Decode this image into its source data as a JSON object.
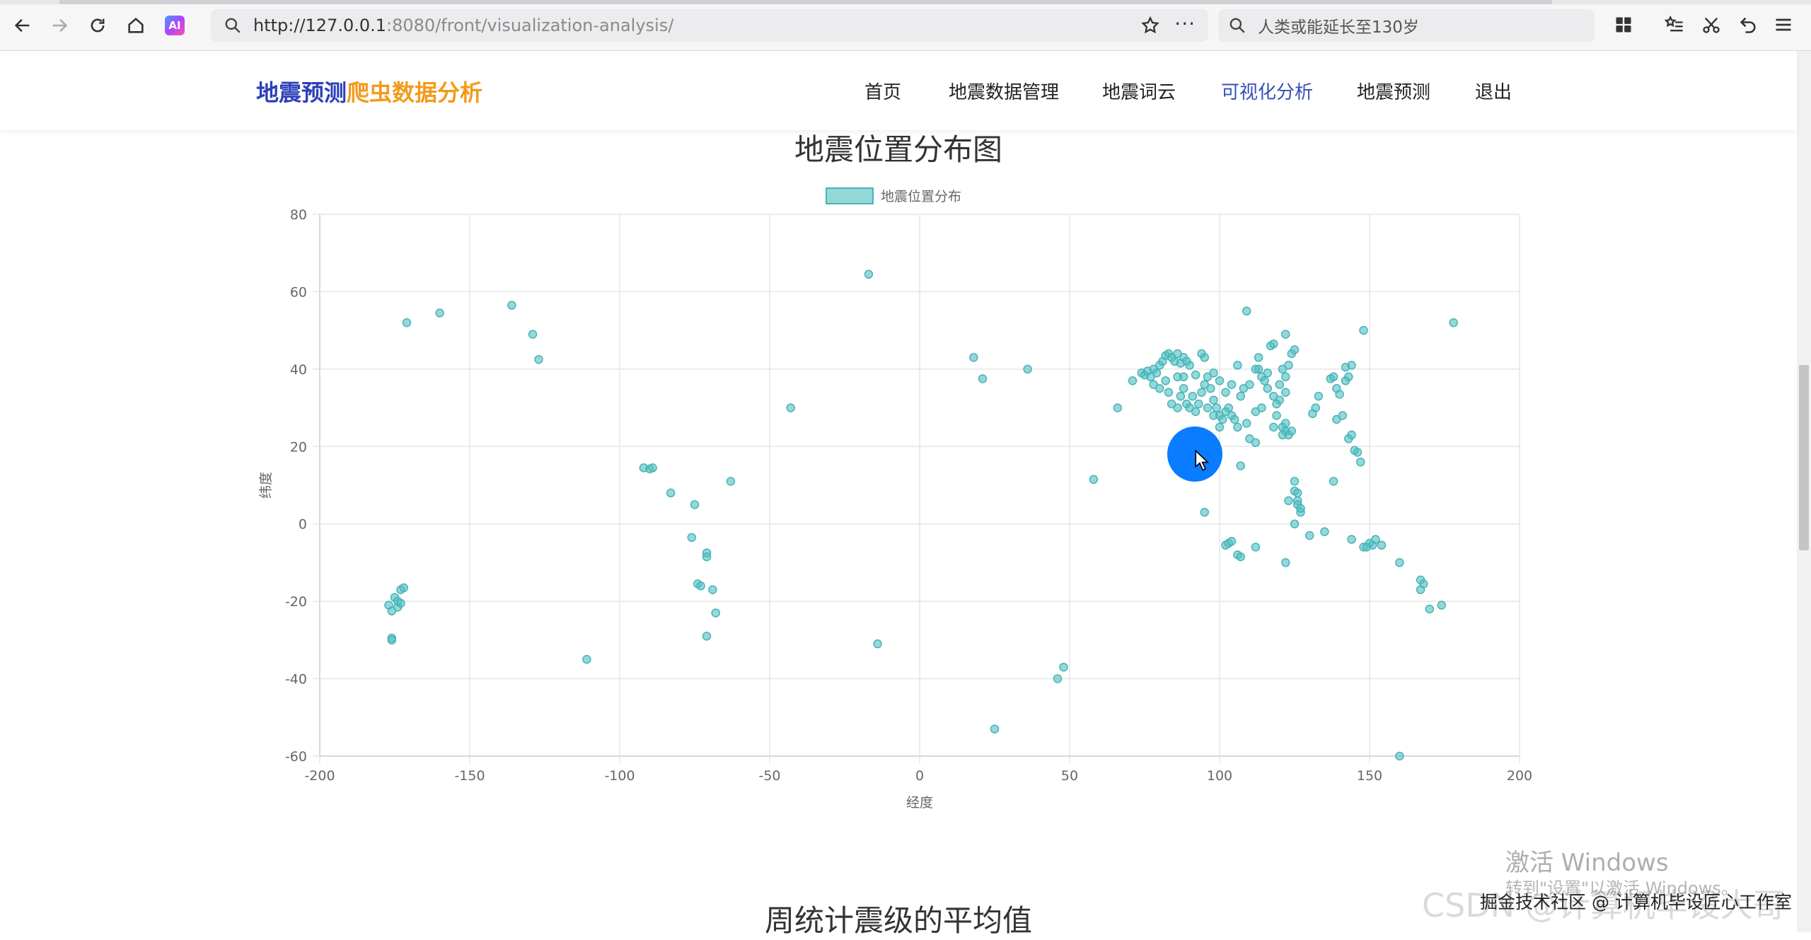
{
  "browser": {
    "url_host": "http://127.0.0.1",
    "url_rest": ":8080/front/visualization-analysis/",
    "search_placeholder": "人类或能延长至130岁",
    "ai_label": "AI",
    "more_label": "···"
  },
  "site": {
    "logo_part1": "地震预测",
    "logo_part2": "爬虫数据分析",
    "nav": [
      "首页",
      "地震数据管理",
      "地震词云",
      "可视化分析",
      "地震预测",
      "退出"
    ],
    "active_nav": "可视化分析"
  },
  "chart_title": "地震位置分布图",
  "section2_title": "周统计震级的平均值",
  "watermark": {
    "line1": "激活 Windows",
    "line2": "转到\"设置\"以激活 Windows。",
    "csdn": "CSDN @计算机毕设大哥",
    "credit": "掘金技术社区 @ 计算机毕设匠心工作室"
  },
  "colors": {
    "point_fill": "rgba(75,192,192,0.6)",
    "point_stroke": "#4bb3b8",
    "grid": "#e6e6e6",
    "active_nav": "#3650b8",
    "logo_blue": "#2d40b8",
    "logo_orange": "#f39a1a"
  },
  "chart_data": {
    "type": "scatter",
    "legend": "地震位置分布",
    "legend_position": "top-center",
    "grid": true,
    "xlabel": "经度",
    "ylabel": "纬度",
    "xlim": [
      -200,
      200
    ],
    "ylim": [
      -60,
      80
    ],
    "xticks": [
      -200,
      -150,
      -100,
      -50,
      0,
      50,
      100,
      150,
      200
    ],
    "yticks": [
      80,
      60,
      40,
      20,
      0,
      -20,
      -40,
      -60
    ],
    "points": [
      [
        -171,
        52
      ],
      [
        -160,
        54.5
      ],
      [
        -136,
        56.5
      ],
      [
        -129,
        49
      ],
      [
        -127,
        42.5
      ],
      [
        -177,
        -21
      ],
      [
        -176,
        -22.5
      ],
      [
        -175,
        -19
      ],
      [
        -174,
        -21.5
      ],
      [
        -173,
        -17
      ],
      [
        -172,
        -16.5
      ],
      [
        -174,
        -20
      ],
      [
        -176,
        -29.5
      ],
      [
        -176,
        -30
      ],
      [
        -173,
        -20.5
      ],
      [
        -111,
        -35
      ],
      [
        -92,
        14.5
      ],
      [
        -90,
        14.2
      ],
      [
        -89,
        14.5
      ],
      [
        -83,
        8
      ],
      [
        -76,
        -3.5
      ],
      [
        -75,
        5
      ],
      [
        -74,
        -15.5
      ],
      [
        -73,
        -16
      ],
      [
        -71,
        -7.5
      ],
      [
        -71,
        -8.5
      ],
      [
        -69,
        -17
      ],
      [
        -68,
        -23
      ],
      [
        -71,
        -29
      ],
      [
        -63,
        11
      ],
      [
        -43,
        30
      ],
      [
        -17,
        64.5
      ],
      [
        -14,
        -31
      ],
      [
        18,
        43
      ],
      [
        21,
        37.5
      ],
      [
        36,
        40
      ],
      [
        58,
        11.5
      ],
      [
        48,
        -37
      ],
      [
        46,
        -40
      ],
      [
        25,
        -53
      ],
      [
        66,
        30
      ],
      [
        71,
        37
      ],
      [
        74,
        39
      ],
      [
        75,
        38.5
      ],
      [
        76,
        39.5
      ],
      [
        77,
        38
      ],
      [
        78,
        40
      ],
      [
        79,
        39
      ],
      [
        80,
        41
      ],
      [
        81,
        42
      ],
      [
        82,
        43.5
      ],
      [
        83,
        44
      ],
      [
        84,
        43
      ],
      [
        85,
        42
      ],
      [
        86,
        44
      ],
      [
        87,
        41.5
      ],
      [
        88,
        43
      ],
      [
        89,
        42
      ],
      [
        90,
        41
      ],
      [
        78,
        36
      ],
      [
        80,
        35
      ],
      [
        82,
        37
      ],
      [
        83,
        34
      ],
      [
        84,
        31
      ],
      [
        86,
        30
      ],
      [
        87,
        33
      ],
      [
        88,
        35
      ],
      [
        89,
        31
      ],
      [
        90,
        30
      ],
      [
        91,
        33
      ],
      [
        92,
        29
      ],
      [
        93,
        31
      ],
      [
        94,
        34
      ],
      [
        95,
        36
      ],
      [
        96,
        38
      ],
      [
        97,
        35
      ],
      [
        98,
        32
      ],
      [
        99,
        30
      ],
      [
        100,
        28
      ],
      [
        101,
        27
      ],
      [
        102,
        29
      ],
      [
        103,
        30
      ],
      [
        104,
        28
      ],
      [
        105,
        27
      ],
      [
        106,
        25
      ],
      [
        107,
        33
      ],
      [
        108,
        35
      ],
      [
        109,
        26
      ],
      [
        110,
        22
      ],
      [
        112,
        21
      ],
      [
        113,
        40
      ],
      [
        114,
        38
      ],
      [
        115,
        37
      ],
      [
        116,
        39
      ],
      [
        118,
        33
      ],
      [
        119,
        31
      ],
      [
        120,
        32
      ],
      [
        121,
        25
      ],
      [
        122,
        24
      ],
      [
        123,
        23
      ],
      [
        124,
        24
      ],
      [
        121,
        23
      ],
      [
        122,
        26
      ],
      [
        118,
        25
      ],
      [
        119,
        28
      ],
      [
        109,
        55
      ],
      [
        117,
        46
      ],
      [
        118,
        46.5
      ],
      [
        122,
        49
      ],
      [
        124,
        44
      ],
      [
        125,
        45
      ],
      [
        123,
        41
      ],
      [
        122,
        38
      ],
      [
        121,
        40
      ],
      [
        122,
        34
      ],
      [
        86,
        38
      ],
      [
        88,
        38
      ],
      [
        92,
        38.5
      ],
      [
        94,
        44
      ],
      [
        95,
        43
      ],
      [
        98,
        39
      ],
      [
        100,
        37
      ],
      [
        102,
        34
      ],
      [
        104,
        36
      ],
      [
        106,
        41
      ],
      [
        110,
        36
      ],
      [
        112,
        40
      ],
      [
        113,
        43
      ],
      [
        116,
        35
      ],
      [
        120,
        36
      ],
      [
        112,
        29
      ],
      [
        114,
        30
      ],
      [
        96,
        30
      ],
      [
        98,
        28
      ],
      [
        100,
        25
      ],
      [
        131,
        28.5
      ],
      [
        132,
        30
      ],
      [
        133,
        33
      ],
      [
        137,
        37.5
      ],
      [
        138,
        38
      ],
      [
        139,
        35
      ],
      [
        140,
        33.5
      ],
      [
        142,
        37
      ],
      [
        143,
        38
      ],
      [
        142,
        40.5
      ],
      [
        144,
        41
      ],
      [
        139,
        27
      ],
      [
        141,
        28
      ],
      [
        143,
        22
      ],
      [
        144,
        23
      ],
      [
        145,
        19
      ],
      [
        146,
        18.5
      ],
      [
        147,
        16
      ],
      [
        148,
        50
      ],
      [
        178,
        52
      ],
      [
        123,
        6
      ],
      [
        125,
        8.5
      ],
      [
        126,
        6
      ],
      [
        126,
        5
      ],
      [
        127,
        3
      ],
      [
        125,
        0
      ],
      [
        125,
        11
      ],
      [
        126,
        8
      ],
      [
        127,
        4
      ],
      [
        138,
        11
      ],
      [
        135,
        -2
      ],
      [
        130,
        -3
      ],
      [
        144,
        -4
      ],
      [
        148,
        -6
      ],
      [
        150,
        -5
      ],
      [
        151,
        -5.5
      ],
      [
        152,
        -4
      ],
      [
        154,
        -5.5
      ],
      [
        149,
        -6
      ],
      [
        160,
        -10
      ],
      [
        160,
        -60
      ],
      [
        167,
        -14.5
      ],
      [
        168,
        -15.5
      ],
      [
        167,
        -17
      ],
      [
        170,
        -22
      ],
      [
        174,
        -21
      ],
      [
        102,
        -5.5
      ],
      [
        103,
        -5
      ],
      [
        104,
        -4.5
      ],
      [
        106,
        -8
      ],
      [
        107,
        -8.5
      ],
      [
        112,
        -6
      ],
      [
        122,
        -10
      ],
      [
        95,
        3
      ],
      [
        107,
        15
      ]
    ]
  }
}
